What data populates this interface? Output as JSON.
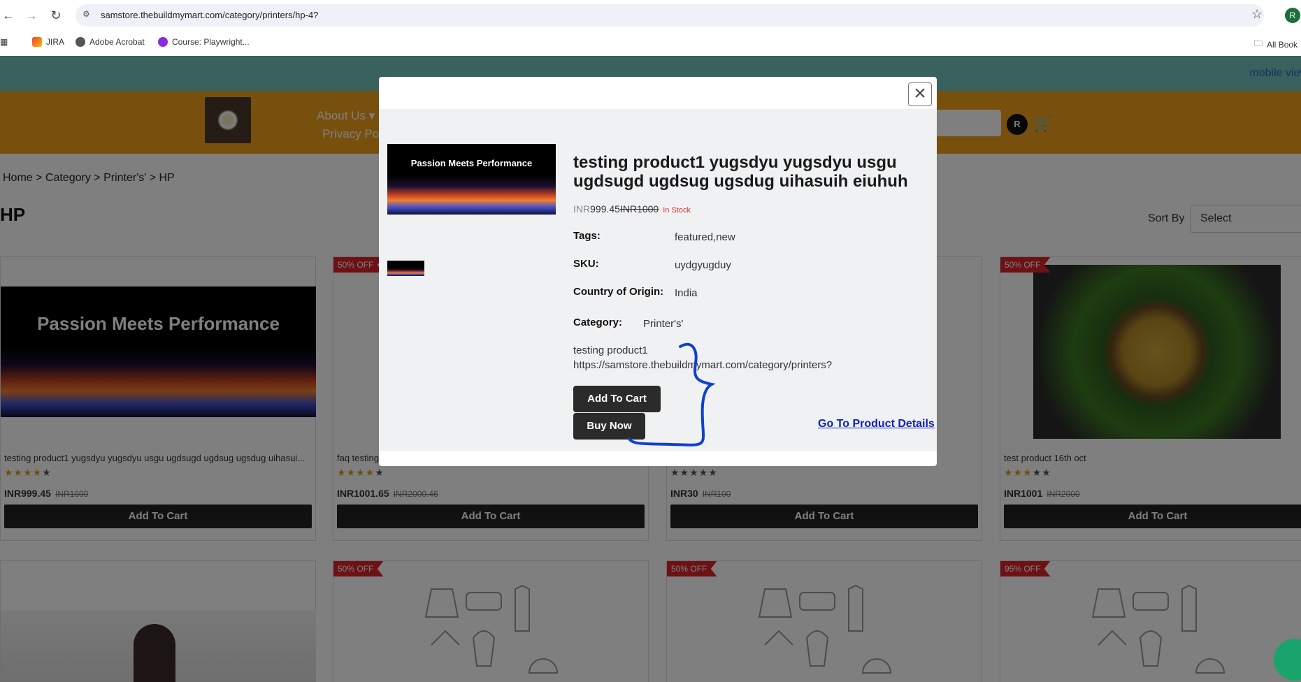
{
  "browser": {
    "url": "samstore.thebuildmymart.com/category/printers/hp-4?",
    "profile_initial": "R",
    "bookmarks": [
      "JIRA",
      "Adobe Acrobat",
      "Course: Playwright...",
      "All Book"
    ]
  },
  "site": {
    "mobile_view": "mobile view",
    "nav": [
      "About Us ▾",
      "Privacy Po"
    ],
    "user_initial": "R"
  },
  "breadcrumb": "Home > Category > Printer's' > HP",
  "page_title": "HP",
  "sort": {
    "label": "Sort By",
    "value": "Select"
  },
  "banner_text": "Passion Meets Performance",
  "products": [
    {
      "name": "testing product1 yugsdyu yugsdyu usgu ugdsugd ugdsug ugsdug uihasui...",
      "stars": "★★★★★",
      "rating": 4,
      "price": "INR999.45",
      "old_price": "INR1000",
      "badge": "",
      "button": "Add To Cart"
    },
    {
      "name": "faq testing",
      "stars": "★★★★★",
      "rating": 4,
      "price": "INR1001.65",
      "old_price": "INR2000.46",
      "badge": "50% OFF",
      "button": "Add To Cart"
    },
    {
      "name": "",
      "stars": "★★★★★",
      "rating": 0,
      "price": "INR30",
      "old_price": "INR100",
      "badge": "",
      "button": "Add To Cart"
    },
    {
      "name": "test product 16th oct",
      "stars": "★★★★★",
      "rating": 3,
      "price": "INR1001",
      "old_price": "INR2000",
      "badge": "50% OFF",
      "button": "Add To Cart"
    }
  ],
  "row2_badges": [
    "",
    "50% OFF",
    "50% OFF",
    "95% OFF"
  ],
  "modal": {
    "title": "testing product1 yugsdyu yugsdyu usgu ugdsugd ugdsug ugsdug uihasuih eiuhuh",
    "currency": "INR",
    "price": "999.45",
    "old_price": "INR1000",
    "stock": "In Stock",
    "tags_label": "Tags:",
    "tags": "featured,new",
    "sku_label": "SKU:",
    "sku": "uydgyugduy",
    "origin_label": "Country of Origin:",
    "origin": "India",
    "category_label": "Category:",
    "category": "Printer's'",
    "desc_line1": "testing product1",
    "desc_line2": "https://samstore.thebuildmymart.com/category/printers?",
    "add_to_cart": "Add To Cart",
    "buy_now": "Buy Now",
    "details_link": "Go To Product Details"
  },
  "colors": {
    "header": "#f0a01a",
    "top_strip": "#73c3bb",
    "badge": "#d9252a",
    "annotation": "#1040d0"
  }
}
